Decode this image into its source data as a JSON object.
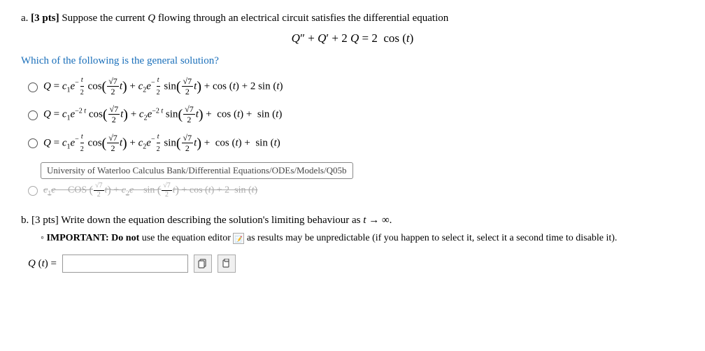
{
  "partA": {
    "label": "a.",
    "pts": "[3 pts]",
    "description": "Suppose the current",
    "var_Q": "Q",
    "description2": "flowing through an electrical circuit satisfies the differential equation",
    "mainEquation": "Q″ + Q′ + 2 Q = 2  cos (t)",
    "questionText": "Which of the following is the general solution?",
    "tooltipText": "University of Waterloo Calculus Bank/Differential Equations/ODEs/Models/Q05b",
    "options": [
      {
        "id": "opt1",
        "text": "Q = c₁e^(−t/2) cos(√7/2 · t) + c₂e^(−t/2) sin(√7/2 · t) + cos(t) + 2 sin(t)"
      },
      {
        "id": "opt2",
        "text": "Q = c₁e^(−2t) cos(√7/2 · t) + c₂e^(−2t) sin(√7/2 · t) + cos(t) + sin(t)"
      },
      {
        "id": "opt3",
        "text": "Q = c₁e^(−t/2) cos(√7/2 · t) + c₂e^(−t/2) sin(√7/2 · t) + cos(t) + sin(t)"
      },
      {
        "id": "opt4",
        "text": "Q = c₁e^(−t) cos(√7/2 · t) + c₂e^(−t) sin(√7/2 · t) + cos(t) + 2 sin(t)",
        "struck": true
      }
    ]
  },
  "partB": {
    "label": "b.",
    "pts": "[3 pts]",
    "description": "Write down the equation describing the solution's limiting behaviour as",
    "var_t": "t",
    "arrow_inf": "→ ∞.",
    "importantNote": "IMPORTANT: Do not use the equation editor",
    "noteRest": "as results may be unpredictable (if you happen to select it, select it a second time to disable it).",
    "answerLabel": "Q (t) =",
    "inputPlaceholder": "",
    "icon1": "📋",
    "icon2": "📋"
  }
}
